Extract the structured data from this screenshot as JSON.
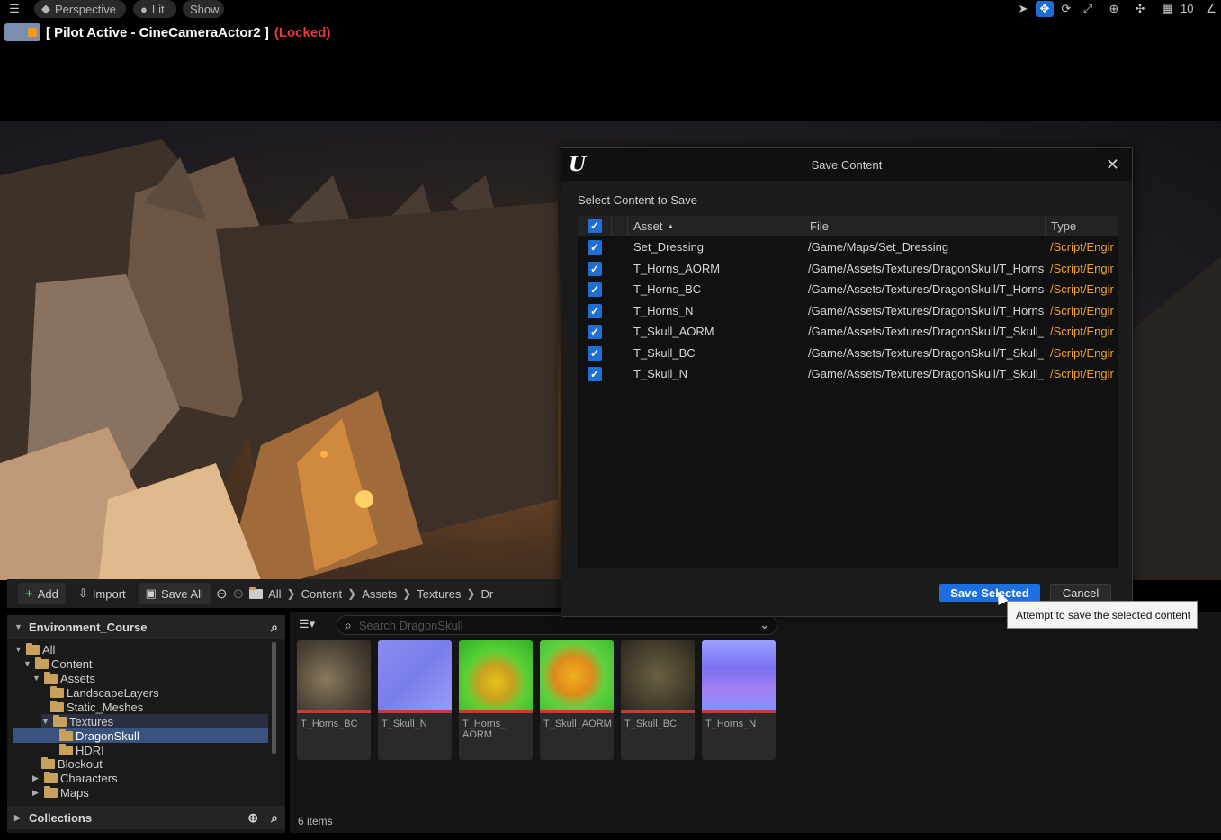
{
  "viewport": {
    "perspective_label": "Perspective",
    "lit_label": "Lit",
    "show_label": "Show",
    "grid_value": "10",
    "pilot_text": "[ Pilot Active - CineCameraActor2 ]",
    "pilot_locked": "(Locked)"
  },
  "content_browser": {
    "add_label": "Add",
    "import_label": "Import",
    "save_all_label": "Save All",
    "breadcrumbs": [
      "All",
      "Content",
      "Assets",
      "Textures",
      "Dr"
    ],
    "source_title": "Environment_Course",
    "tree": [
      "All",
      "Content",
      "Assets",
      "LandscapeLayers",
      "Static_Meshes",
      "Textures",
      "DragonSkull",
      "HDRI",
      "Blockout",
      "Characters",
      "Maps"
    ],
    "collections_label": "Collections",
    "search_placeholder": "Search DragonSkull",
    "assets": [
      {
        "name": "T_Horns_BC"
      },
      {
        "name": "T_Skull_N"
      },
      {
        "name": "T_Horns_\nAORM"
      },
      {
        "name": "T_Skull_AORM"
      },
      {
        "name": "T_Skull_BC"
      },
      {
        "name": "T_Horns_N"
      }
    ],
    "item_count": "6 items"
  },
  "dialog": {
    "title": "Save Content",
    "subtitle": "Select Content to Save",
    "columns": {
      "asset": "Asset",
      "file": "File",
      "type": "Type"
    },
    "rows": [
      {
        "asset": "Set_Dressing",
        "file": "/Game/Maps/Set_Dressing",
        "type": "/Script/Engir"
      },
      {
        "asset": "T_Horns_AORM",
        "file": "/Game/Assets/Textures/DragonSkull/T_Horns",
        "type": "/Script/Engir"
      },
      {
        "asset": "T_Horns_BC",
        "file": "/Game/Assets/Textures/DragonSkull/T_Horns",
        "type": "/Script/Engir"
      },
      {
        "asset": "T_Horns_N",
        "file": "/Game/Assets/Textures/DragonSkull/T_Horns",
        "type": "/Script/Engir"
      },
      {
        "asset": "T_Skull_AORM",
        "file": "/Game/Assets/Textures/DragonSkull/T_Skull_",
        "type": "/Script/Engir"
      },
      {
        "asset": "T_Skull_BC",
        "file": "/Game/Assets/Textures/DragonSkull/T_Skull_",
        "type": "/Script/Engir"
      },
      {
        "asset": "T_Skull_N",
        "file": "/Game/Assets/Textures/DragonSkull/T_Skull_",
        "type": "/Script/Engir"
      }
    ],
    "save_selected_label": "Save Selected",
    "cancel_label": "Cancel",
    "tooltip": "Attempt to save the selected content"
  },
  "colors": {
    "accent": "#1d6fe0",
    "locked": "#e23b3b",
    "type_text": "#f0a030"
  }
}
